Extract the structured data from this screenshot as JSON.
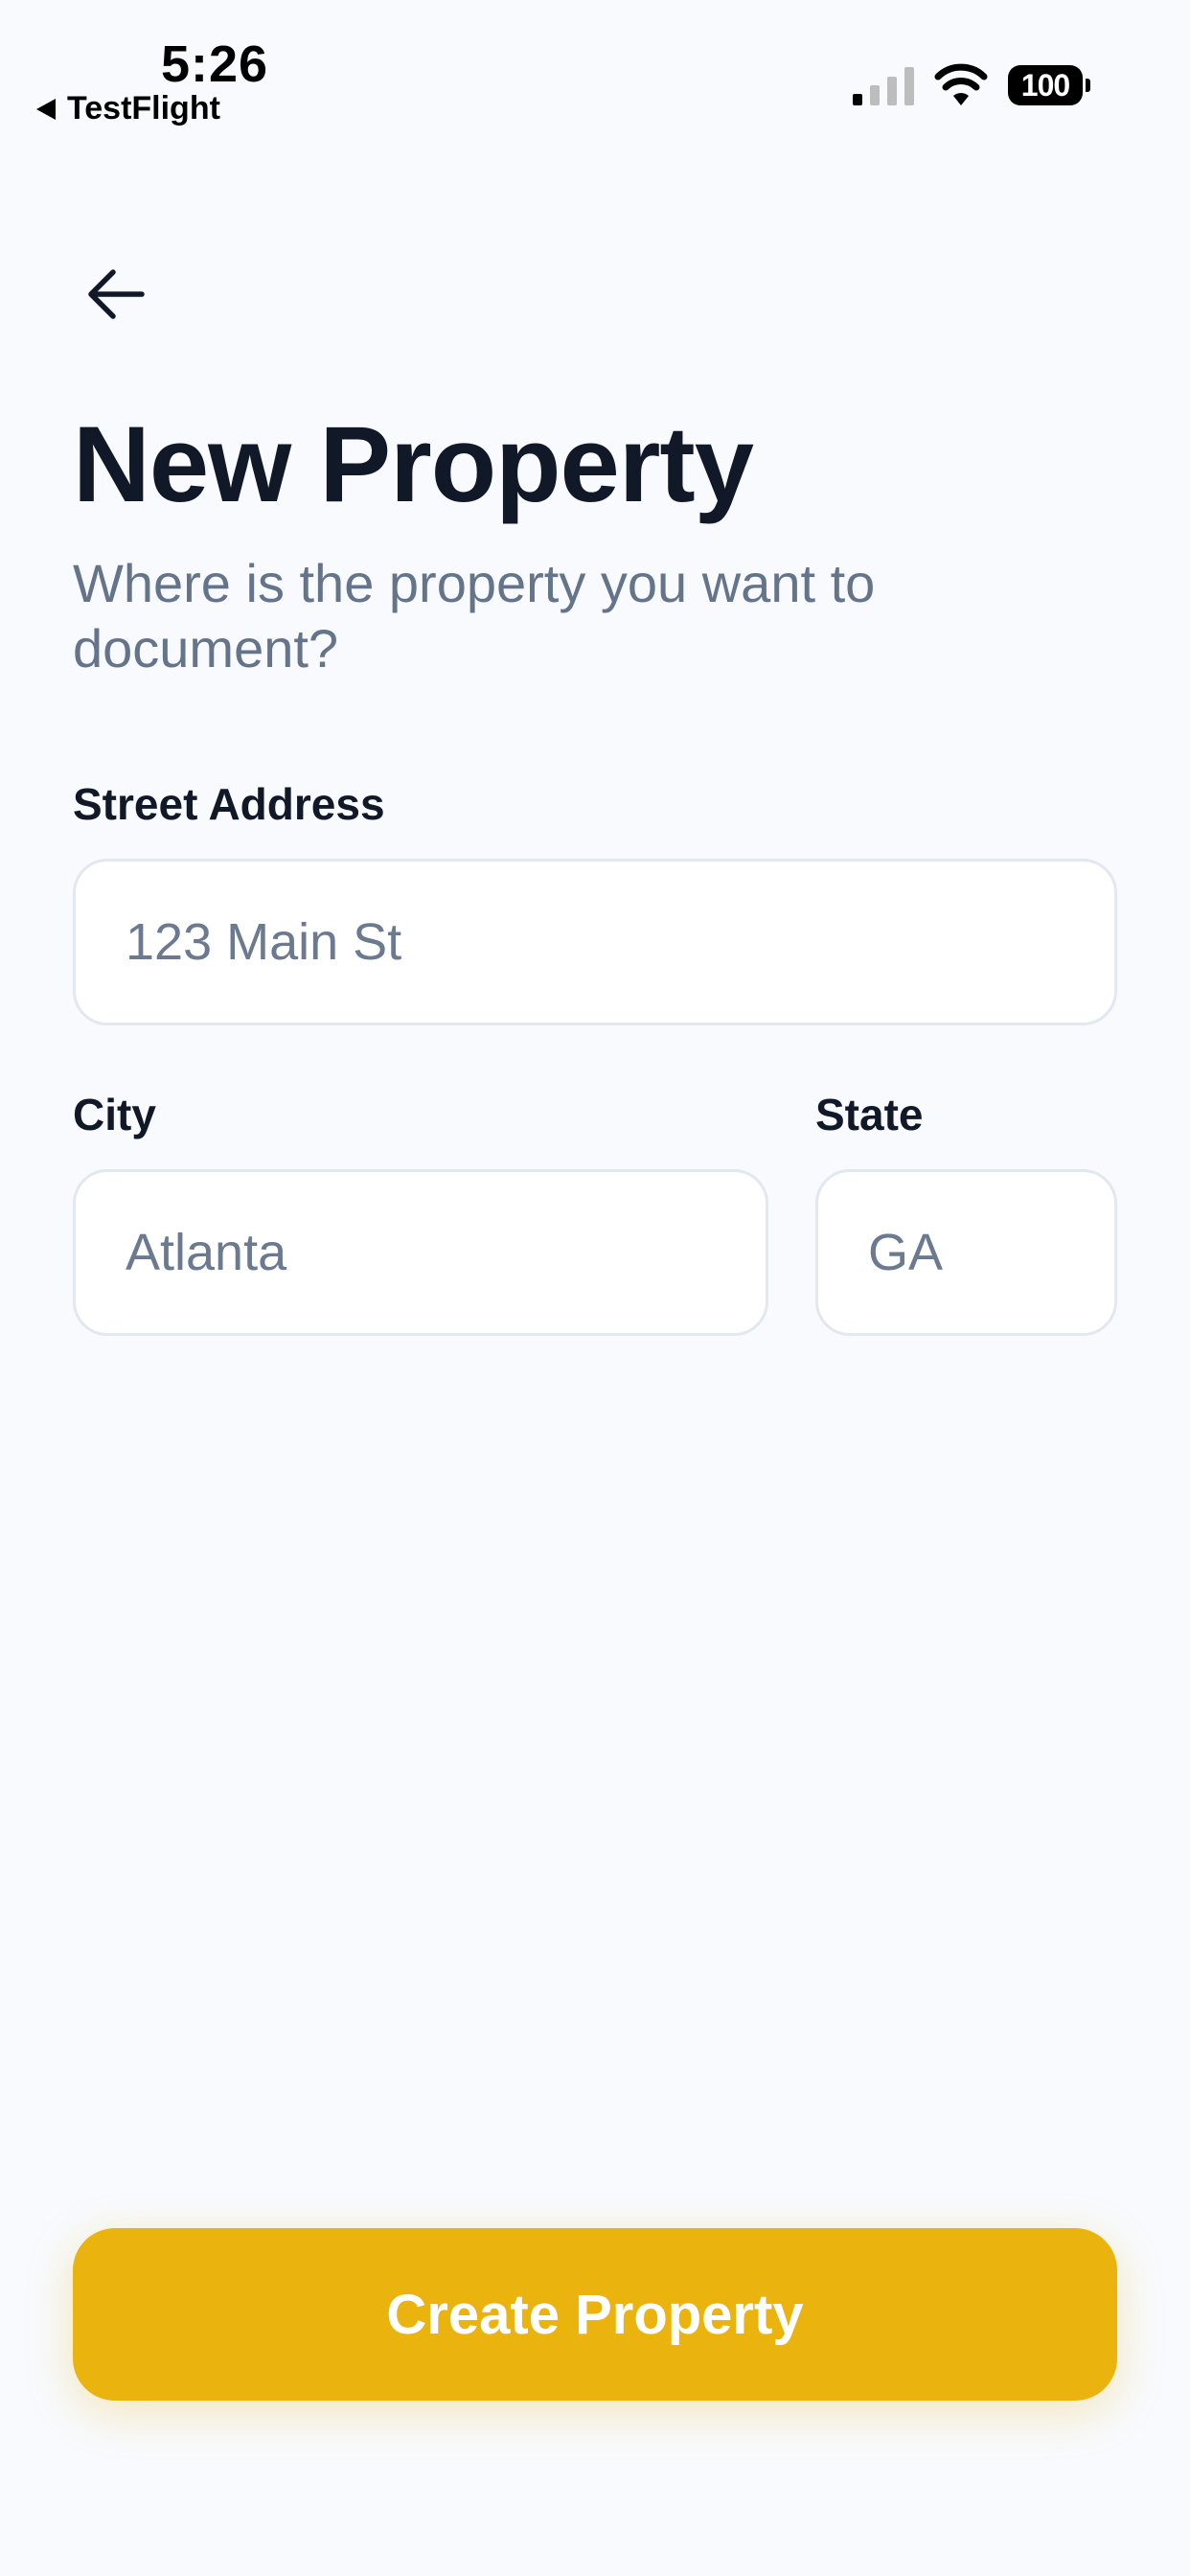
{
  "status_bar": {
    "time": "5:26",
    "back_app": "TestFlight",
    "battery": "100"
  },
  "header": {
    "back_icon": "arrow-left-icon",
    "title": "New Property",
    "subtitle": "Where is the property you want to document?"
  },
  "form": {
    "street": {
      "label": "Street Address",
      "placeholder": "123 Main St",
      "value": ""
    },
    "city": {
      "label": "City",
      "placeholder": "Atlanta",
      "value": ""
    },
    "state": {
      "label": "State",
      "placeholder": "GA",
      "value": ""
    }
  },
  "actions": {
    "create_label": "Create Property"
  },
  "colors": {
    "background": "#F8FAFD",
    "accent": "#EAB30E",
    "title": "#111827",
    "subtitle": "#64748B",
    "placeholder": "#6B7A90",
    "input_border": "#E2E8F0"
  }
}
